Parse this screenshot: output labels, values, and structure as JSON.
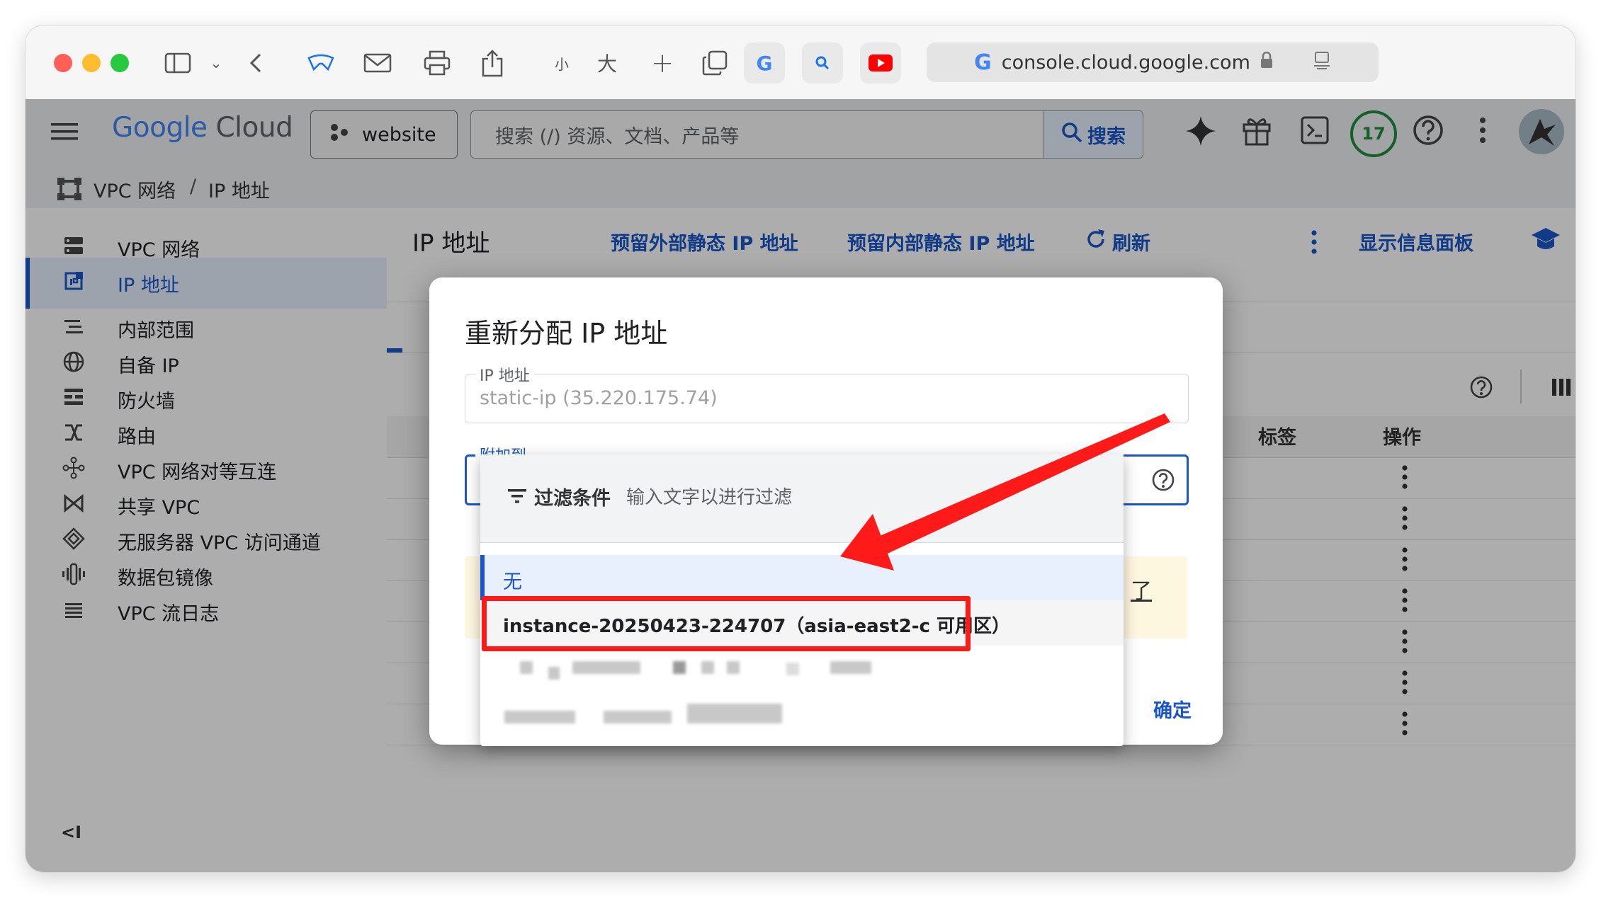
{
  "browser": {
    "url": "console.cloud.google.com",
    "text_small": "小",
    "text_large": "大"
  },
  "header": {
    "logo_google": "Google",
    "logo_cloud": "Cloud",
    "project": "website",
    "search_placeholder": "搜索 (/) 资源、文档、产品等",
    "search_button": "搜索",
    "notification_count": "17"
  },
  "breadcrumb": {
    "section": "VPC 网络",
    "separator": "/",
    "page": "IP 地址"
  },
  "sidebar": {
    "items": [
      {
        "label": "VPC 网络",
        "icon": "vpc-network-icon"
      },
      {
        "label": "IP 地址",
        "icon": "ip-address-icon"
      },
      {
        "label": "内部范围",
        "icon": "internal-range-icon"
      },
      {
        "label": "自备 IP",
        "icon": "globe-icon"
      },
      {
        "label": "防火墙",
        "icon": "firewall-icon"
      },
      {
        "label": "路由",
        "icon": "route-icon"
      },
      {
        "label": "VPC 网络对等互连",
        "icon": "peering-icon"
      },
      {
        "label": "共享 VPC",
        "icon": "shared-vpc-icon"
      },
      {
        "label": "无服务器 VPC 访问通道",
        "icon": "serverless-icon"
      },
      {
        "label": "数据包镜像",
        "icon": "packet-mirror-icon"
      },
      {
        "label": "VPC 流日志",
        "icon": "flow-logs-icon"
      }
    ],
    "active_index": 1,
    "collapse_label": "<I"
  },
  "main": {
    "title": "IP 地址",
    "reserve_external": "预留外部静态 IP 地址",
    "reserve_internal": "预留内部静态 IP 地址",
    "refresh": "刷新",
    "show_info_panel": "显示信息面板",
    "col_labels": "标签",
    "col_actions": "操作"
  },
  "dialog": {
    "title": "重新分配 IP 地址",
    "ip_label": "IP 地址",
    "ip_value": "static-ip (35.220.175.74)",
    "attach_label": "附加到",
    "notice_suffix": "了",
    "confirm": "确定",
    "menu": {
      "filter_label": "过滤条件",
      "filter_placeholder": "输入文字以进行过滤",
      "option_none": "无",
      "option_instance": "instance-20250423-224707（asia-east2-c 可用区）"
    }
  },
  "colors": {
    "accent": "#1a56c8",
    "highlight": "#ff1a1a",
    "active_bg": "#e8f0fe"
  }
}
